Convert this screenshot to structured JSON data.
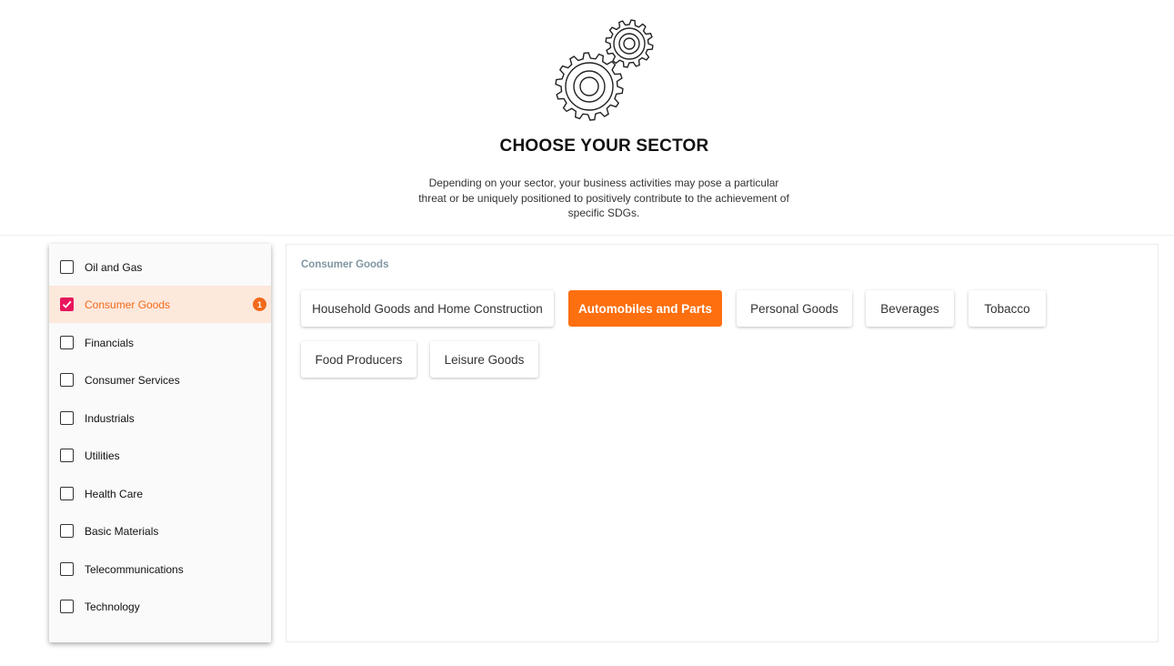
{
  "header": {
    "title": "CHOOSE YOUR SECTOR",
    "description": "Depending on your sector, your business activities may pose a particular threat or be uniquely positioned to positively contribute to the achievement of specific SDGs.",
    "icon": "gears-icon"
  },
  "sidebar": {
    "items": [
      {
        "label": "Oil and Gas",
        "checked": false
      },
      {
        "label": "Consumer Goods",
        "checked": true,
        "badge": "1"
      },
      {
        "label": "Financials",
        "checked": false
      },
      {
        "label": "Consumer Services",
        "checked": false
      },
      {
        "label": "Industrials",
        "checked": false
      },
      {
        "label": "Utilities",
        "checked": false
      },
      {
        "label": "Health Care",
        "checked": false
      },
      {
        "label": "Basic Materials",
        "checked": false
      },
      {
        "label": "Telecommunications",
        "checked": false
      },
      {
        "label": "Technology",
        "checked": false
      }
    ]
  },
  "panel": {
    "title": "Consumer Goods",
    "chips": [
      {
        "label": "Household Goods and Home Construction",
        "selected": false
      },
      {
        "label": "Automobiles and Parts",
        "selected": true
      },
      {
        "label": "Personal Goods",
        "selected": false
      },
      {
        "label": "Beverages",
        "selected": false
      },
      {
        "label": "Tobacco",
        "selected": false
      },
      {
        "label": "Food Producers",
        "selected": false
      },
      {
        "label": "Leisure Goods",
        "selected": false
      }
    ]
  },
  "colors": {
    "accent": "#fe6f0f",
    "checkbox_checked": "#e8175d",
    "active_row": "#fde8dc",
    "panel_title": "#7f97a1"
  }
}
